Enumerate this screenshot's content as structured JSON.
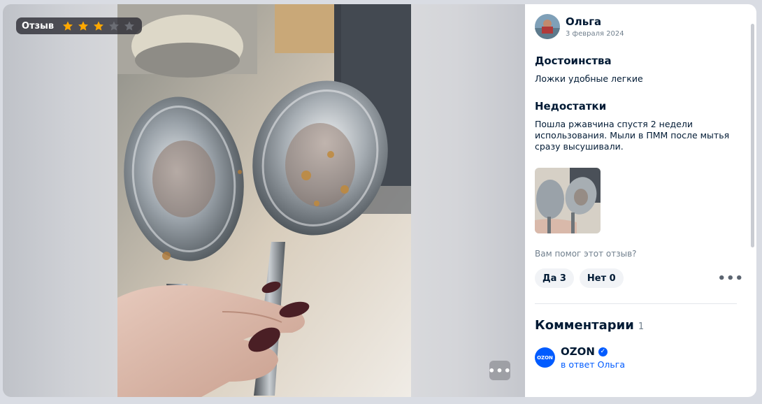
{
  "badge": {
    "label": "Отзыв",
    "rating": 3,
    "max_rating": 5
  },
  "review": {
    "author": "Ольга",
    "date": "3 февраля 2024",
    "pros_title": "Достоинства",
    "pros_text": "Ложки удобные легкие",
    "cons_title": "Недостатки",
    "cons_text": "Пошла ржавчина спустя 2 недели использования. Мыли в ПММ после мытья сразу высушивали."
  },
  "helpful": {
    "question": "Вам помог этот отзыв?",
    "yes_label": "Да 3",
    "no_label": "Нет 0",
    "more_icon": "more-dots-icon"
  },
  "comments": {
    "title": "Комментарии",
    "count": "1",
    "items": [
      {
        "author": "OZON",
        "logo_text": "OZON",
        "reply_to": "в ответ Ольга",
        "verified": true
      }
    ]
  },
  "colors": {
    "brand": "#005bff",
    "star": "#ffa800",
    "text": "#001a34",
    "muted": "#707f8d"
  }
}
